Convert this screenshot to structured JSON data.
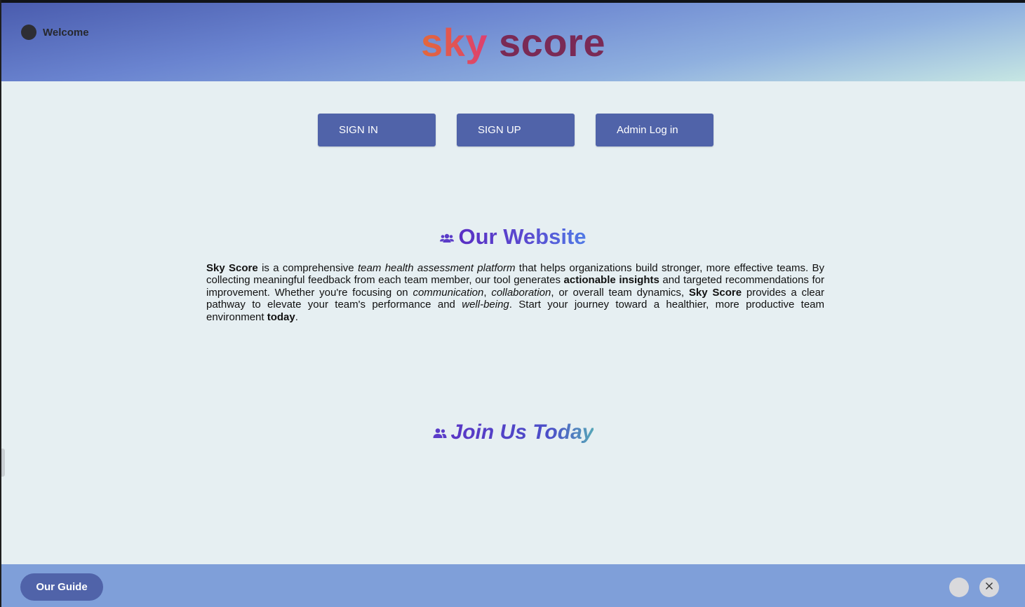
{
  "header": {
    "welcome": "Welcome",
    "brand_part1": "sky",
    "brand_part2": "score"
  },
  "auth_buttons": {
    "sign_in": "SIGN IN",
    "sign_up": "SIGN UP",
    "admin": "Admin Log in"
  },
  "website_section": {
    "title": "Our Website",
    "icon": "users-icon",
    "description": [
      {
        "text": "Sky Score",
        "style": "bold"
      },
      {
        "text": " is a comprehensive ",
        "style": "normal"
      },
      {
        "text": "team health assessment platform",
        "style": "italic"
      },
      {
        "text": " that helps organizations build stronger, more effective teams. By collecting meaningful feedback from each team member, our tool generates ",
        "style": "normal"
      },
      {
        "text": "actionable insights",
        "style": "bold"
      },
      {
        "text": " and targeted recommendations for improvement. Whether you're focusing on ",
        "style": "normal"
      },
      {
        "text": "communication",
        "style": "italic"
      },
      {
        "text": ", ",
        "style": "normal"
      },
      {
        "text": "collaboration",
        "style": "italic"
      },
      {
        "text": ", or overall team dynamics, ",
        "style": "normal"
      },
      {
        "text": "Sky Score",
        "style": "bold"
      },
      {
        "text": " provides a clear pathway to elevate your team's performance and ",
        "style": "normal"
      },
      {
        "text": "well-being",
        "style": "italic"
      },
      {
        "text": ". Start your journey toward a healthier, more productive team environment ",
        "style": "normal"
      },
      {
        "text": "today",
        "style": "bold"
      },
      {
        "text": ".",
        "style": "normal"
      }
    ]
  },
  "join_section": {
    "title": "Join Us Today",
    "icon": "user-friends-icon"
  },
  "footer": {
    "guide_button": "Our Guide",
    "close_icon": "close-icon"
  },
  "colors": {
    "button": "#5063a9",
    "page_bg": "#e6eff2",
    "footer_bg": "#7f9fd9"
  }
}
